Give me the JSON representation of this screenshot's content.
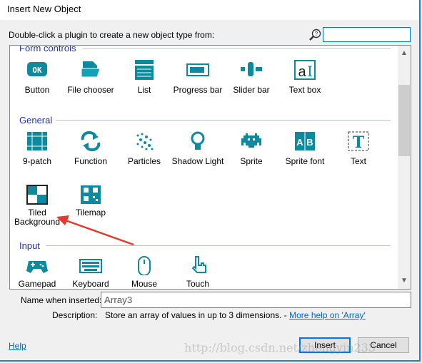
{
  "window": {
    "title": "Insert New Object"
  },
  "prompt": "Double-click a plugin to create a new object type from:",
  "search": {
    "value": "",
    "icon": "search-help-icon"
  },
  "sections": [
    {
      "title": "Form controls",
      "items": [
        {
          "label": "Button",
          "icon": "ok-button-icon"
        },
        {
          "label": "File chooser",
          "icon": "folder-icon"
        },
        {
          "label": "List",
          "icon": "list-icon"
        },
        {
          "label": "Progress bar",
          "icon": "progress-bar-icon"
        },
        {
          "label": "Slider bar",
          "icon": "slider-icon"
        },
        {
          "label": "Text box",
          "icon": "text-box-icon"
        }
      ]
    },
    {
      "title": "General",
      "items": [
        {
          "label": "9-patch",
          "icon": "nine-patch-icon"
        },
        {
          "label": "Function",
          "icon": "function-arrows-icon"
        },
        {
          "label": "Particles",
          "icon": "particles-icon"
        },
        {
          "label": "Shadow Light",
          "icon": "lightbulb-icon"
        },
        {
          "label": "Sprite",
          "icon": "space-invader-icon"
        },
        {
          "label": "Sprite font",
          "icon": "sprite-font-icon"
        },
        {
          "label": "Text",
          "icon": "text-icon"
        },
        {
          "label": "Tiled Background",
          "icon": "tiled-background-icon"
        },
        {
          "label": "Tilemap",
          "icon": "tilemap-icon"
        }
      ]
    },
    {
      "title": "Input",
      "items": [
        {
          "label": "Gamepad",
          "icon": "gamepad-icon"
        },
        {
          "label": "Keyboard",
          "icon": "keyboard-icon"
        },
        {
          "label": "Mouse",
          "icon": "mouse-icon"
        },
        {
          "label": "Touch",
          "icon": "touch-icon"
        }
      ]
    }
  ],
  "name_label": "Name when inserted:",
  "name_value": "Array3",
  "desc_label": "Description:",
  "desc_text": "Store an array of values in up to 3 dimensions. - ",
  "desc_link": "More help on 'Array'",
  "help": "Help",
  "insert": "Insert",
  "cancel": "Cancel",
  "watermark": "http://blog.csdn.net/zhengyin233",
  "accent": "#0e8a9e"
}
